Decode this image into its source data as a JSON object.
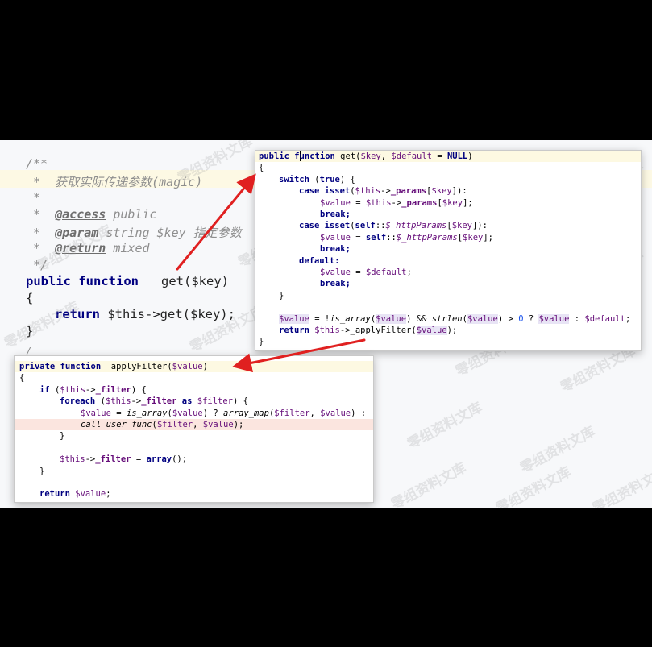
{
  "base_editor": {
    "comment_lines": [
      "/**",
      " *  获取实际传递参数(magic)",
      " *",
      " *  ",
      " *  ",
      " *  ",
      " */"
    ],
    "doc_access_tag": "@access",
    "doc_access_value": " public",
    "doc_param_tag": "@param",
    "doc_param_value": " string $key 指定参数",
    "doc_return_tag": "@return",
    "doc_return_value": " mixed",
    "sig_public": "public",
    "sig_function": "function",
    "sig_rest": " __get($key)",
    "open_brace": "{",
    "return_kw": "return",
    "return_rest": " $this->get($key);",
    "close_brace": "}",
    "trailing": "/"
  },
  "popup_get": {
    "l1_public": "public ",
    "l1_f": "f",
    "l1_unction": "unction",
    "l1_name": " get(",
    "l1_key": "$key",
    "l1_mid": ", ",
    "l1_default": "$default",
    "l1_eq": " = ",
    "l1_null": "NULL",
    "l1_close": ")",
    "l2": "{",
    "l3_switch": "switch",
    "l3_open": " (",
    "l3_true": "true",
    "l3_close": ") {",
    "l4_case": "case ",
    "l4_isset": "isset",
    "l4_open": "(",
    "l4_this": "$this",
    "l4_arrow": "->",
    "l4_params": "_params",
    "l4_idx": "[",
    "l4_key": "$key",
    "l4_end": "]):",
    "l5_value": "$value",
    "l5_eq": " = ",
    "l5_this": "$this",
    "l5_arrow": "->",
    "l5_params": "_params",
    "l5_idx": "[",
    "l5_key": "$key",
    "l5_end": "];",
    "l6": "break;",
    "l7_case": "case ",
    "l7_isset": "isset",
    "l7_open": "(",
    "l7_self": "self",
    "l7_colon": "::",
    "l7_http": "$_httpParams",
    "l7_idx": "[",
    "l7_key": "$key",
    "l7_end": "]):",
    "l8_value": "$value",
    "l8_eq": " = ",
    "l8_self": "self",
    "l8_colon": "::",
    "l8_http": "$_httpParams",
    "l8_idx": "[",
    "l8_key": "$key",
    "l8_end": "];",
    "l9": "break;",
    "l10": "default:",
    "l11_value": "$value",
    "l11_eq": " = ",
    "l11_default": "$default",
    "l11_end": ";",
    "l12": "break;",
    "l13": "}",
    "l15_value": "$value",
    "l15_eq": " = !",
    "l15_isarray": "is_array",
    "l15_open": "(",
    "l15_v2": "$value",
    "l15_and": ") && ",
    "l15_strlen": "strlen",
    "l15_open2": "(",
    "l15_v3": "$value",
    "l15_gt": ") > ",
    "l15_zero": "0",
    "l15_q": " ? ",
    "l15_v4": "$value",
    "l15_colon": " : ",
    "l15_default": "$default",
    "l15_end": ";",
    "l16_return": "return ",
    "l16_this": "$this",
    "l16_arrow": "->_applyFilter(",
    "l16_value": "$value",
    "l16_end": ");",
    "l17": "}"
  },
  "popup_apply": {
    "l1_private": "private ",
    "l1_function": "function",
    "l1_name": " _applyFilter(",
    "l1_value": "$value",
    "l1_close": ")",
    "l2": "{",
    "l3_if": "if",
    "l3_open": " (",
    "l3_this": "$this",
    "l3_arrow": "->",
    "l3_filter": "_filter",
    "l3_close": ") {",
    "l4_foreach": "foreach",
    "l4_open": " (",
    "l4_this": "$this",
    "l4_arrow": "->",
    "l4_filter": "_filter",
    "l4_as": " as ",
    "l4_fvar": "$filter",
    "l4_close": ") {",
    "l5_value": "$value",
    "l5_eq": " = ",
    "l5_isarray": "is_array",
    "l5_open": "(",
    "l5_v2": "$value",
    "l5_q": ") ? ",
    "l5_map": "array_map",
    "l5_open2": "(",
    "l5_filter": "$filter",
    "l5_comma": ", ",
    "l5_v3": "$value",
    "l5_end": ") :",
    "l6_call": "call_user_func",
    "l6_open": "(",
    "l6_filter": "$filter",
    "l6_comma": ", ",
    "l6_value": "$value",
    "l6_end": ");",
    "l7": "}",
    "l9_this": "$this",
    "l9_arrow": "->",
    "l9_filter": "_filter",
    "l9_eq": " = ",
    "l9_array": "array",
    "l9_end": "();",
    "l10": "}",
    "l12_return": "return ",
    "l12_value": "$value",
    "l12_end": ";"
  },
  "watermark_text": "零组资料文库",
  "colors": {
    "arrow": "#e02020",
    "background": "#000000",
    "editor_bg": "#f7f8fa"
  }
}
